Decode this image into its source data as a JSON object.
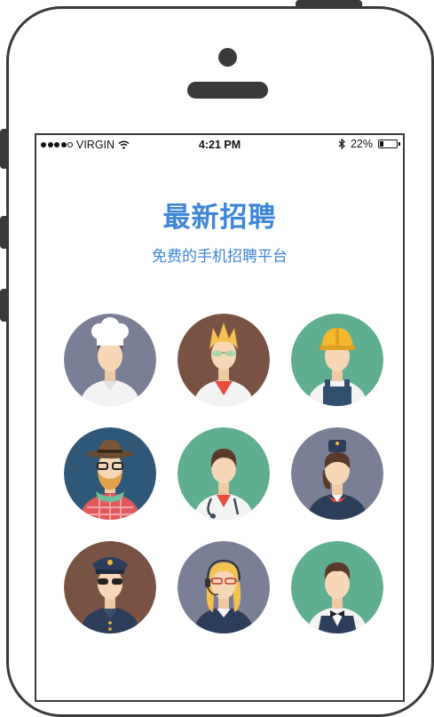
{
  "status_bar": {
    "carrier": "VIRGIN",
    "time": "4:21 PM",
    "battery_percent": "22%",
    "battery_level": 0.22,
    "signal_dots_filled": 4,
    "signal_dots_total": 5,
    "icons": [
      "wifi-icon",
      "bluetooth-icon",
      "battery-icon"
    ]
  },
  "header": {
    "title": "最新招聘",
    "subtitle": "免费的手机招聘平台"
  },
  "colors": {
    "accent": "#3e86d8",
    "frame": "#3a3a3c"
  },
  "avatars": [
    {
      "role": "chef",
      "bg": "#7b7f96"
    },
    {
      "role": "scientist",
      "bg": "#7a5244"
    },
    {
      "role": "construction-worker",
      "bg": "#5fae90"
    },
    {
      "role": "hipster",
      "bg": "#2f5878"
    },
    {
      "role": "doctor",
      "bg": "#5fae90"
    },
    {
      "role": "flight-attendant",
      "bg": "#7b7f96"
    },
    {
      "role": "police-officer",
      "bg": "#7a5244"
    },
    {
      "role": "call-center-operator",
      "bg": "#7b7f96"
    },
    {
      "role": "waiter",
      "bg": "#5fae90"
    }
  ]
}
